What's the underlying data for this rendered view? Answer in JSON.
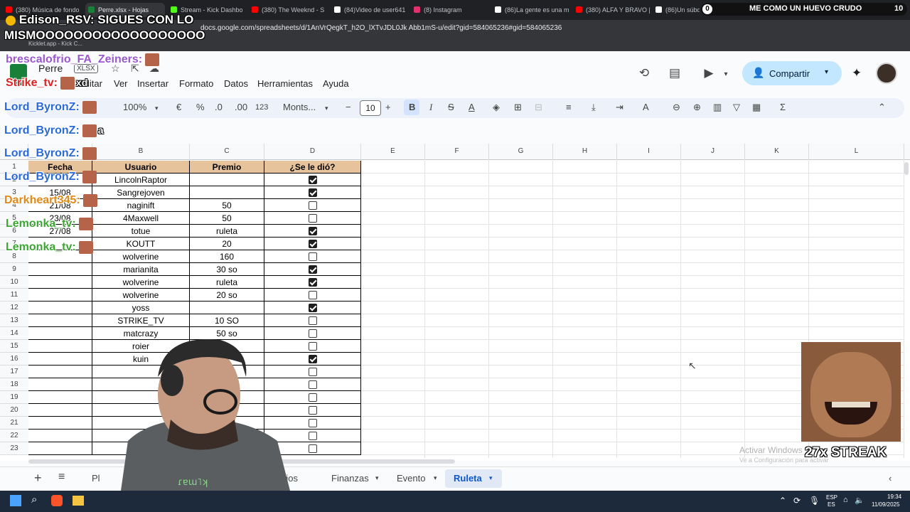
{
  "browser": {
    "tabs": [
      {
        "label": "(380) Música de fondo",
        "color": "#ff0000"
      },
      {
        "label": "Perre.xlsx - Hojas",
        "color": "#188038"
      },
      {
        "label": "Stream - Kick Dashbo",
        "color": "#53fc18"
      },
      {
        "label": "(380) The Weeknd - S",
        "color": "#ff0000"
      },
      {
        "label": "(84)Video de user641",
        "color": "#ffffff"
      },
      {
        "label": "(8) Instagram",
        "color": "#e1306c"
      },
      {
        "label": "(86)La gente es una m",
        "color": "#ffffff"
      },
      {
        "label": "(380) ALFA Y BRAVO |",
        "color": "#ff0000"
      },
      {
        "label": "(86)Un súbd",
        "color": "#ffffff"
      }
    ],
    "url": "docs.google.com/spreadsheets/d/1AnVrQegkT_h2O_lXTvJDL0Jk Abb1mS-u/edit?gid=584065236#gid=584065236",
    "bookmark": "Kicklet.app - Kick C..."
  },
  "doc": {
    "title": "Perre",
    "badge": "XLSX",
    "menu": [
      "Editar",
      "Ver",
      "Insertar",
      "Formato",
      "Datos",
      "Herramientas",
      "Ayuda"
    ],
    "share_label": "Compartir"
  },
  "toolbar": {
    "zoom": "100%",
    "currency": "€",
    "percent": "%",
    "dec_minus": ".0",
    "dec_plus": ".00",
    "num_format": "123",
    "font": "Monts...",
    "font_size": "10",
    "bold": "B",
    "italic": "I",
    "strike": "S",
    "text_color": "A"
  },
  "columns": [
    "",
    "B",
    "C",
    "D",
    "E",
    "F",
    "G",
    "H",
    "I",
    "J",
    "K",
    "L"
  ],
  "table": {
    "headers": [
      "Fecha",
      "Usuario",
      "Premio",
      "¿Se le dió?"
    ],
    "rows": [
      {
        "n": "2",
        "fecha": "",
        "usuario": "LincolnRaptor",
        "premio": "",
        "done": true
      },
      {
        "n": "3",
        "fecha": "15/08",
        "usuario": "Sangrejoven",
        "premio": "",
        "done": true
      },
      {
        "n": "4",
        "fecha": "21/08",
        "usuario": "naginift",
        "premio": "50",
        "done": false
      },
      {
        "n": "5",
        "fecha": "23/08",
        "usuario": "4Maxwell",
        "premio": "50",
        "done": false
      },
      {
        "n": "6",
        "fecha": "27/08",
        "usuario": "totue",
        "premio": "ruleta",
        "done": true
      },
      {
        "n": "7",
        "fecha": "",
        "usuario": "KOUTT",
        "premio": "20",
        "done": true
      },
      {
        "n": "8",
        "fecha": "",
        "usuario": "wolverine",
        "premio": "160",
        "done": false
      },
      {
        "n": "9",
        "fecha": "",
        "usuario": "marianita",
        "premio": "30 so",
        "done": true
      },
      {
        "n": "10",
        "fecha": "",
        "usuario": "wolverine",
        "premio": "ruleta",
        "done": true
      },
      {
        "n": "11",
        "fecha": "",
        "usuario": "wolverine",
        "premio": "20 so",
        "done": false
      },
      {
        "n": "12",
        "fecha": "",
        "usuario": "yoss",
        "premio": "",
        "done": true
      },
      {
        "n": "13",
        "fecha": "",
        "usuario": "STRIKE_TV",
        "premio": "10 SO",
        "done": false
      },
      {
        "n": "14",
        "fecha": "",
        "usuario": "matcrazy",
        "premio": "50 so",
        "done": false
      },
      {
        "n": "15",
        "fecha": "",
        "usuario": "roier",
        "premio": "",
        "done": false
      },
      {
        "n": "16",
        "fecha": "",
        "usuario": "kuin",
        "premio": "",
        "done": true
      },
      {
        "n": "17",
        "fecha": "",
        "usuario": "",
        "premio": "",
        "done": false
      },
      {
        "n": "18",
        "fecha": "",
        "usuario": "",
        "premio": "",
        "done": false
      },
      {
        "n": "19",
        "fecha": "",
        "usuario": "",
        "premio": "",
        "done": false
      },
      {
        "n": "20",
        "fecha": "",
        "usuario": "",
        "premio": "",
        "done": false
      },
      {
        "n": "21",
        "fecha": "",
        "usuario": "",
        "premio": "",
        "done": false
      },
      {
        "n": "22",
        "fecha": "",
        "usuario": "",
        "premio": "",
        "done": false
      },
      {
        "n": "23",
        "fecha": "",
        "usuario": "",
        "premio": "",
        "done": false
      }
    ]
  },
  "sheets": {
    "tabs": [
      "Pl",
      "rios",
      "Finanzas",
      "Evento",
      "Ruleta"
    ],
    "active": "Ruleta"
  },
  "taskbar": {
    "lang": "ESP",
    "lang2": "ES",
    "time": "19:34",
    "date": "11/09/2025"
  },
  "overlay": {
    "top_user": "Edison_RSV:",
    "top_msg": "SIGUES CON LO",
    "top_msg2": "MISMOOOOOOOOOOOOOOOOOO",
    "badge_num": "0",
    "banner": "ME COMO UN HUEVO CRUDO",
    "banner_count": "10",
    "chat": [
      {
        "user": "brescalofrio_FA_Zeiners:",
        "color": "#9b59d0",
        "msg": ""
      },
      {
        "user": "Strike_tv:",
        "color": "#e02020",
        "msg": "xd"
      },
      {
        "user": "Lord_ByronZ:",
        "color": "#2a6ad8",
        "msg": ""
      },
      {
        "user": "Lord_ByronZ:",
        "color": "#2a6ad8",
        "msg": "a"
      },
      {
        "user": "Lord_ByronZ:",
        "color": "#2a6ad8",
        "msg": ""
      },
      {
        "user": "Lord_ByronZ:",
        "color": "#2a6ad8",
        "msg": ""
      },
      {
        "user": "Darkheart345:",
        "color": "#e08a1a",
        "msg": ""
      },
      {
        "user": "Lemonka_tv:",
        "color": "#3aa830",
        "msg": ""
      },
      {
        "user": "Lemonka_tv:",
        "color": "#3aa830",
        "msg": ""
      }
    ],
    "streak": "27x STREAK",
    "activate": "Activar Windows",
    "activate2": "Ve a Configuración para activar"
  }
}
